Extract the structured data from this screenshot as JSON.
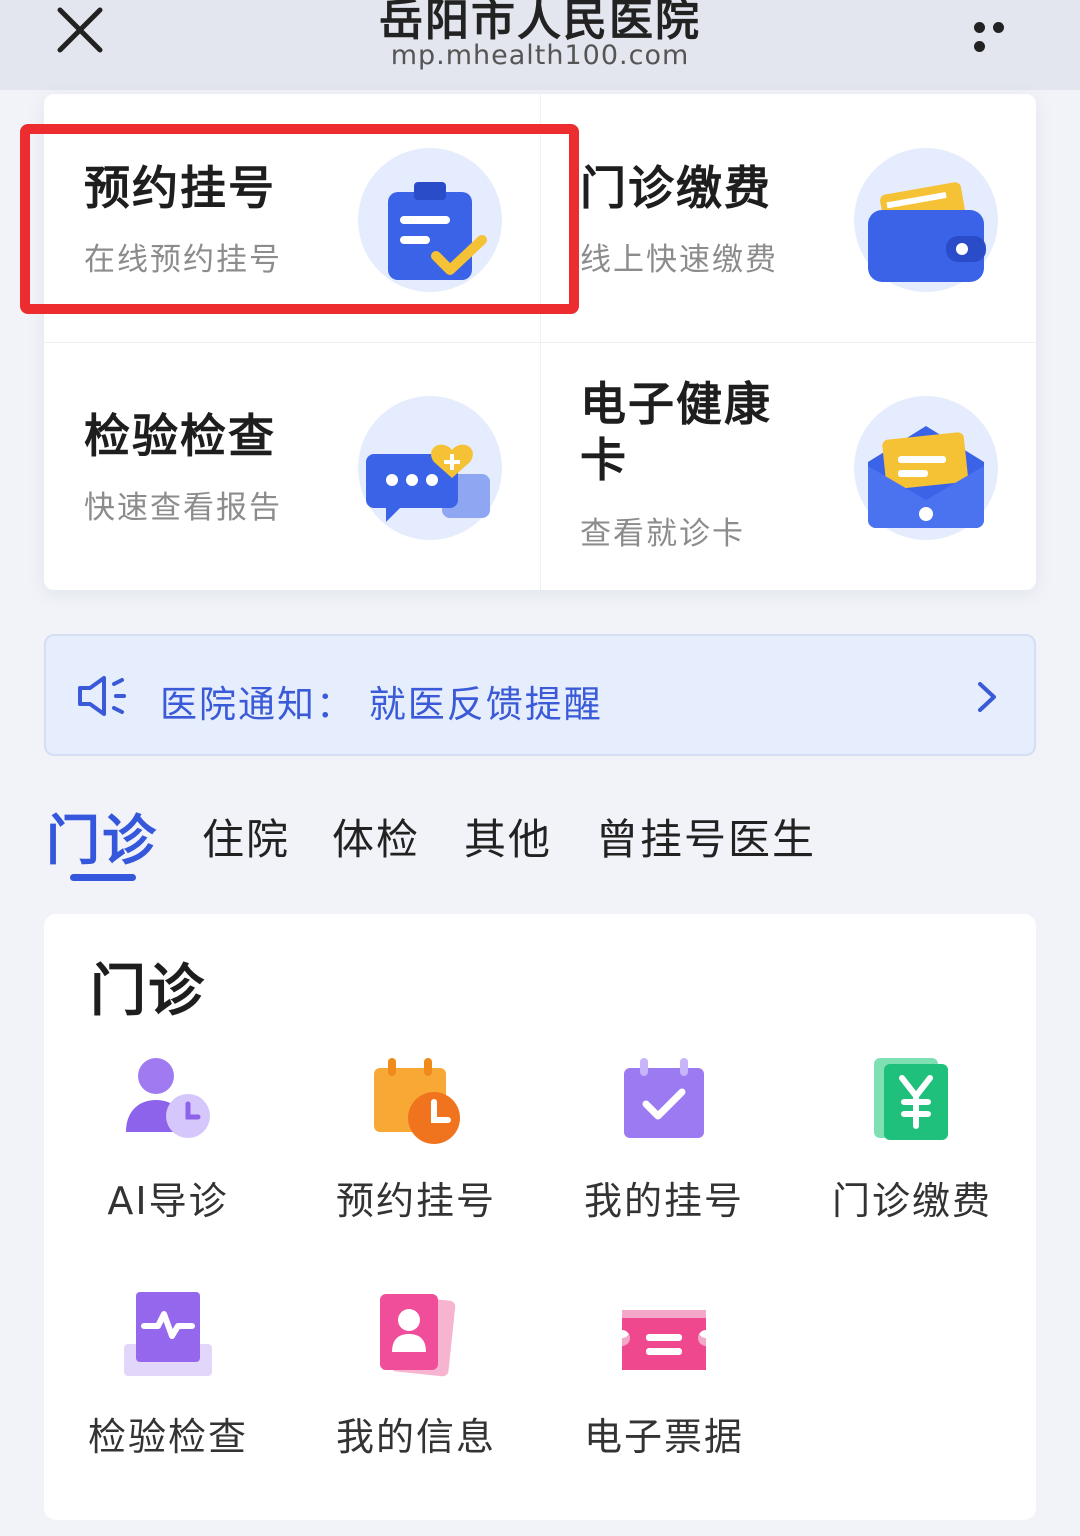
{
  "header": {
    "title": "岳阳市人民医院",
    "url": "mp.mhealth100.com",
    "close_icon": "close-icon",
    "more_icon": "more-icon"
  },
  "quick_grid": [
    {
      "title": "预约挂号",
      "subtitle": "在线预约挂号",
      "icon": "clipboard-check-icon",
      "highlighted": true
    },
    {
      "title": "门诊缴费",
      "subtitle": "线上快速缴费",
      "icon": "wallet-icon"
    },
    {
      "title": "检验检查",
      "subtitle": "快速查看报告",
      "icon": "chat-report-icon"
    },
    {
      "title": "电子健康\n卡",
      "subtitle": "查看就诊卡",
      "icon": "card-envelope-icon"
    }
  ],
  "notice": {
    "text": "医院通知：  就医反馈提醒",
    "icon": "speaker-icon"
  },
  "tabs": [
    {
      "label": "门诊",
      "active": true
    },
    {
      "label": "住院"
    },
    {
      "label": "体检"
    },
    {
      "label": "其他"
    },
    {
      "label": "曾挂号医生"
    }
  ],
  "section": {
    "title": "门诊",
    "items": [
      {
        "label": "AI导诊",
        "icon": "ai-guide-icon"
      },
      {
        "label": "预约挂号",
        "icon": "calendar-clock-icon"
      },
      {
        "label": "我的挂号",
        "icon": "calendar-check-icon"
      },
      {
        "label": "门诊缴费",
        "icon": "yuan-bill-icon"
      },
      {
        "label": "检验检查",
        "icon": "report-pulse-icon"
      },
      {
        "label": "我的信息",
        "icon": "id-card-icon"
      },
      {
        "label": "电子票据",
        "icon": "ticket-icon"
      }
    ]
  },
  "colors": {
    "accent": "#3457db",
    "highlight_border": "#ec2c2e",
    "notice_bg": "#e6edfc"
  }
}
